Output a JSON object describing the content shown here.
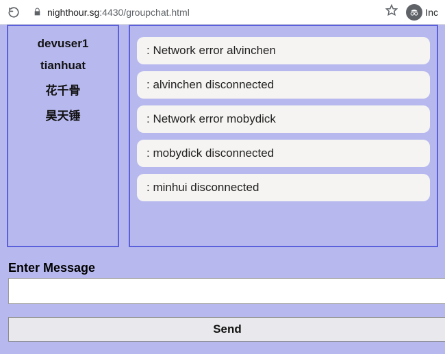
{
  "browser": {
    "url_host": "nighthour.sg",
    "url_rest": ":4430/groupchat.html",
    "profile_label": "Inc"
  },
  "users": [
    "devuser1",
    "tianhuat",
    "花千骨",
    "昊天锤"
  ],
  "messages": [
    ": Network error alvinchen",
    ": alvinchen disconnected",
    ": Network error mobydick",
    ": mobydick disconnected",
    ": minhui disconnected"
  ],
  "form": {
    "label": "Enter Message",
    "input_value": "",
    "send_label": "Send"
  }
}
